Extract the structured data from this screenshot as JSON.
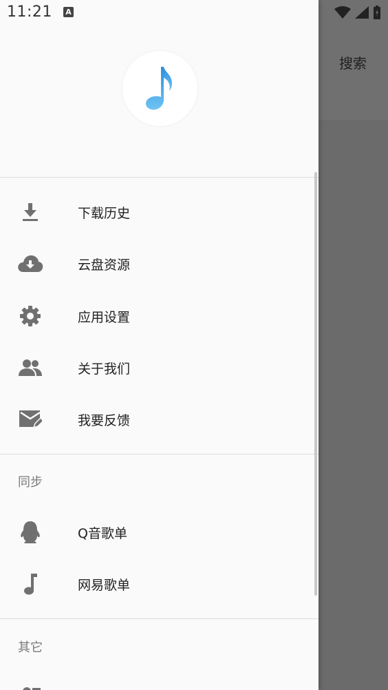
{
  "status_bar": {
    "time": "11:21",
    "notification_icon": "A"
  },
  "background_app": {
    "search_label": "搜索"
  },
  "drawer": {
    "menu": [
      {
        "label": "下载历史",
        "icon": "download-icon"
      },
      {
        "label": "云盘资源",
        "icon": "cloud-download-icon"
      },
      {
        "label": "应用设置",
        "icon": "gear-icon"
      },
      {
        "label": "关于我们",
        "icon": "people-icon"
      },
      {
        "label": "我要反馈",
        "icon": "mail-edit-icon"
      }
    ],
    "sync_section": {
      "title": "同步",
      "items": [
        {
          "label": "Q音歌单",
          "icon": "qq-penguin-icon"
        },
        {
          "label": "网易歌单",
          "icon": "music-note-icon"
        }
      ]
    },
    "other_section": {
      "title": "其它"
    }
  },
  "colors": {
    "accent": "#3aa7e8",
    "icon": "#707070",
    "scrim": "#6b6b6b"
  }
}
